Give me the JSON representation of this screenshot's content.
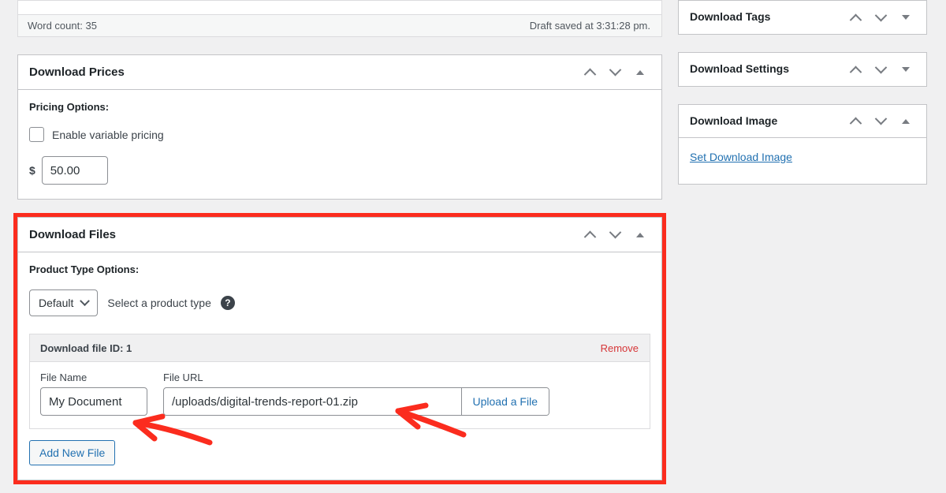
{
  "editor": {
    "word_count": "Word count: 35",
    "draft_status": "Draft saved at 3:31:28 pm."
  },
  "panels": {
    "prices": {
      "title": "Download Prices",
      "pricing_options_label": "Pricing Options:",
      "variable_pricing_label": "Enable variable pricing",
      "variable_pricing_checked": false,
      "currency_symbol": "$",
      "price_value": "50.00"
    },
    "files": {
      "title": "Download Files",
      "product_type_label": "Product Type Options:",
      "product_type_selected": "Default",
      "product_type_hint": "Select a product type",
      "help_icon_glyph": "?",
      "file_row": {
        "id_label": "Download file ID: 1",
        "remove_label": "Remove",
        "file_name_label": "File Name",
        "file_name_value": "My Document",
        "file_url_label": "File URL",
        "file_url_value": "/uploads/digital-trends-report-01.zip",
        "upload_label": "Upload a File"
      },
      "add_new_file_label": "Add New File",
      "highlighted": true,
      "highlight_color": "#fb2c1e"
    }
  },
  "sidebar": {
    "panels": [
      {
        "title": "Download Tags",
        "collapsed": true
      },
      {
        "title": "Download Settings",
        "collapsed": true
      },
      {
        "title": "Download Image",
        "collapsed": false,
        "link_label": "Set Download Image"
      }
    ]
  },
  "annotations": {
    "arrow_color": "#fb2c1e",
    "arrow_count": 2
  },
  "icons": {
    "order_up": "chevron-up-icon",
    "order_down": "chevron-down-icon",
    "toggle": "triangle-toggle-icon"
  }
}
